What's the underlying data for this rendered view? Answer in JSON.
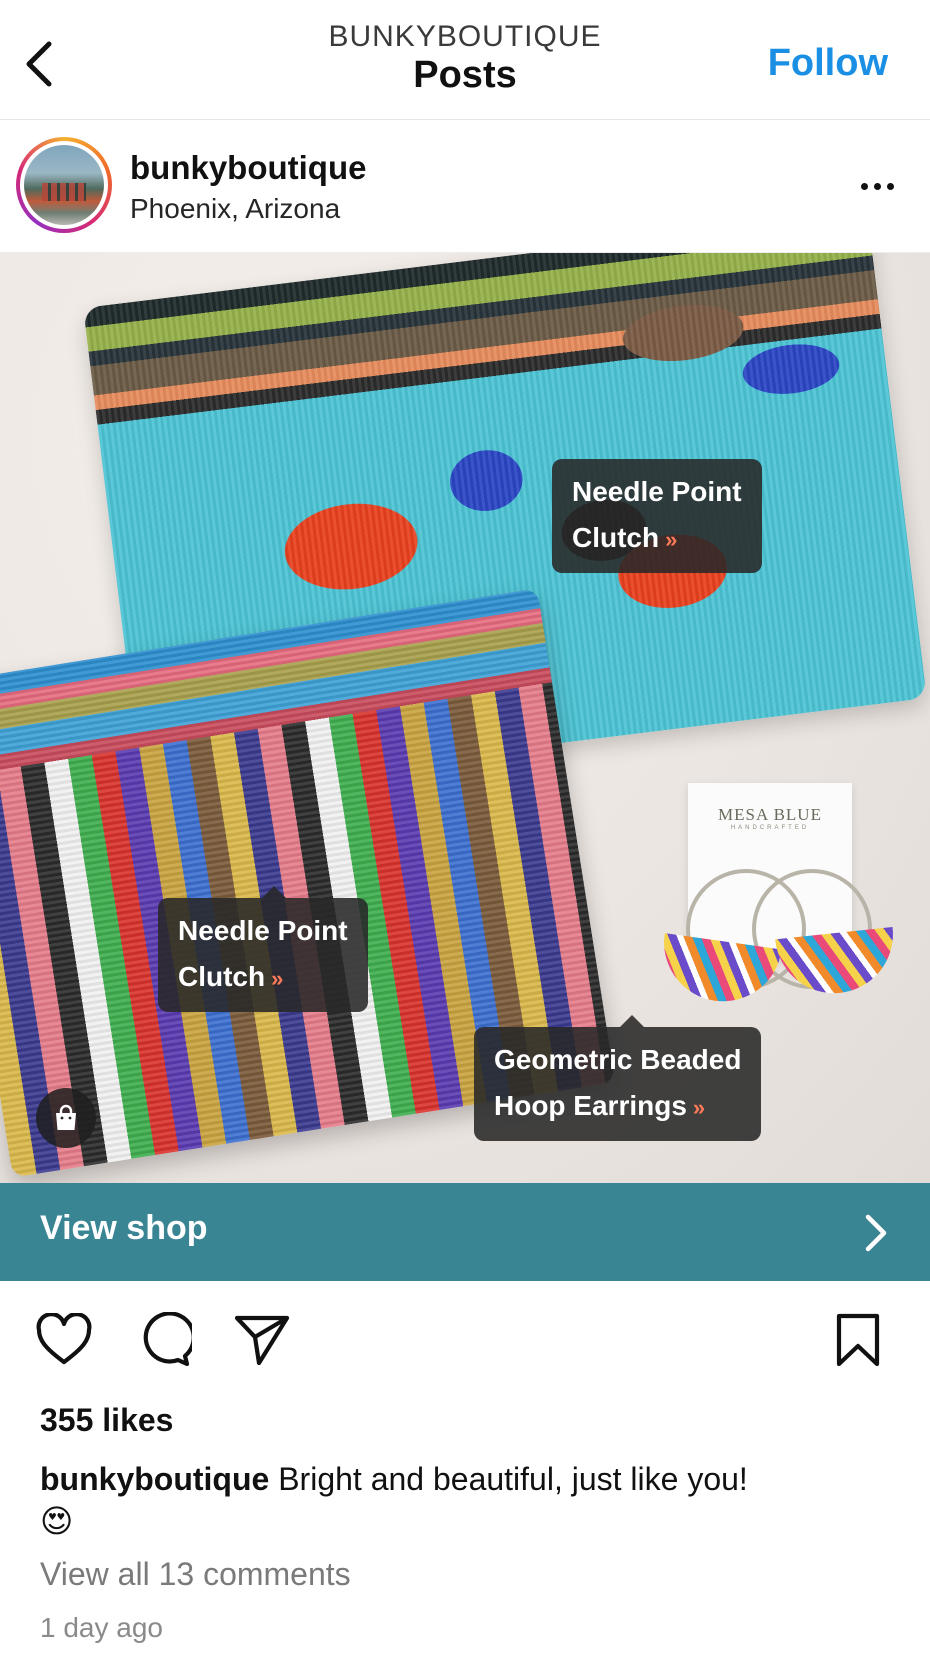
{
  "header": {
    "subtitle": "BUNKYBOUTIQUE",
    "title": "Posts",
    "follow_label": "Follow",
    "back_icon": "chevron-left-icon"
  },
  "post": {
    "username": "bunkyboutique",
    "location": "Phoenix, Arizona",
    "more_icon": "more-horizontal-icon",
    "image": {
      "card_brand": "MESA BLUE",
      "card_sub": "HANDCRAFTED",
      "tags": [
        {
          "line1": "Needle Point",
          "line2": "Clutch",
          "arrow": "»"
        },
        {
          "line1": "Needle Point",
          "line2": "Clutch",
          "arrow": "»"
        },
        {
          "line1": "Geometric Beaded",
          "line2": "Hoop Earrings",
          "arrow": "»"
        }
      ],
      "shop_icon": "shopping-bag-icon"
    },
    "view_shop_label": "View shop",
    "actions": [
      "heart-icon",
      "comment-icon",
      "send-icon",
      "bookmark-icon"
    ],
    "likes": "355 likes",
    "caption_user": "bunkyboutique",
    "caption_text": " Bright and beautiful, just like you!",
    "caption_emoji": "😍",
    "comments_link": "View all 13 comments",
    "time_ago": "1 day ago"
  },
  "colors": {
    "accent_blue": "#1a8fe3",
    "view_shop_bg": "#3a8594",
    "tag_bg": "#282828",
    "tag_arrow": "#ff7a59"
  }
}
